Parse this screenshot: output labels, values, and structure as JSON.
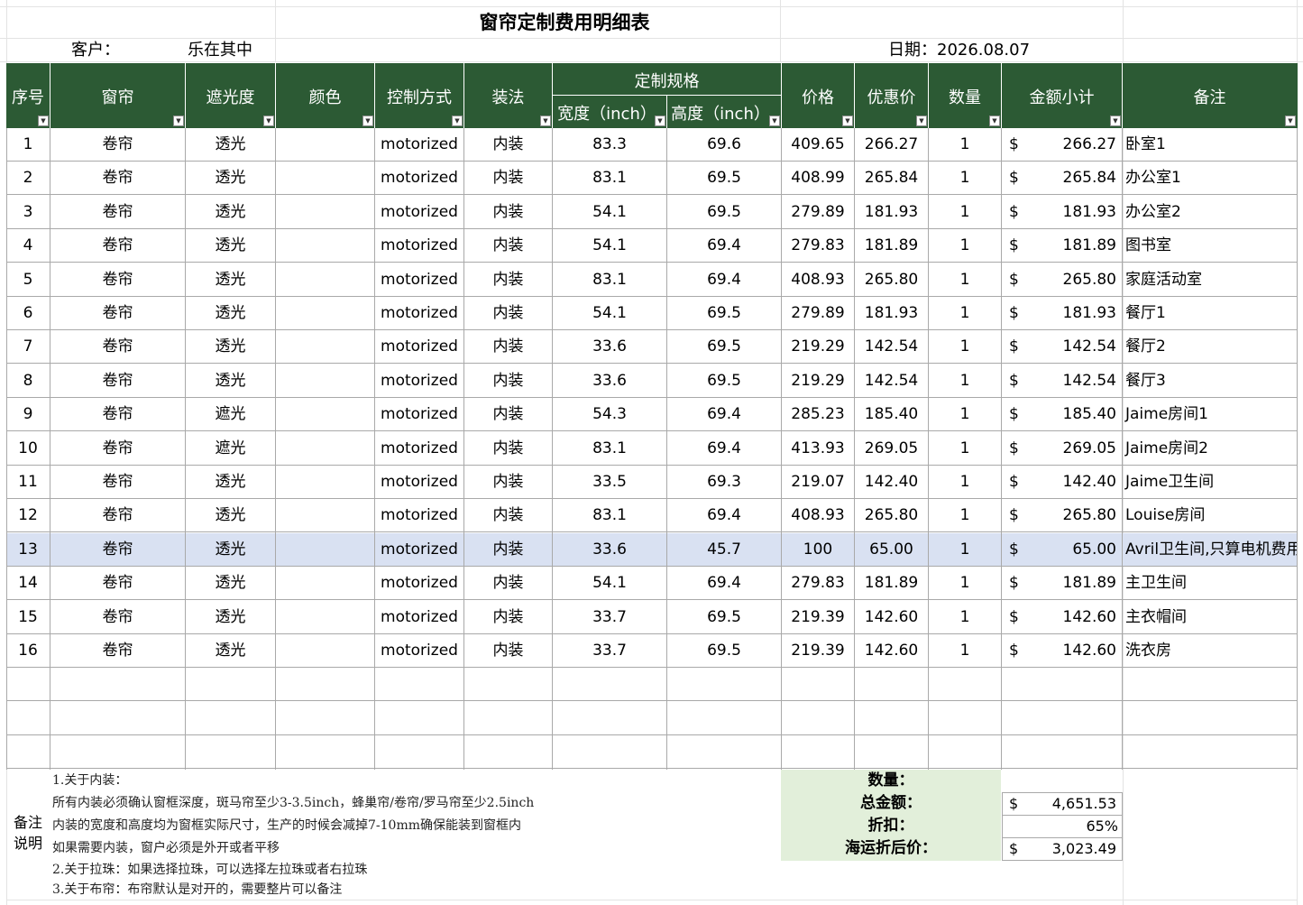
{
  "title": "窗帘定制费用明细表",
  "customer_label": "客户：",
  "customer_name": "乐在其中",
  "date_text": "日期：2026.08.07",
  "header": {
    "seq": "序号",
    "curtain": "窗帘",
    "shading": "遮光度",
    "color": "颜色",
    "control": "控制方式",
    "install": "装法",
    "spec": "定制规格",
    "width": "宽度（inch）",
    "height": "高度（inch）",
    "price": "价格",
    "discount_price": "优惠价",
    "qty": "数量",
    "subtotal": "金额小计",
    "note": "备注"
  },
  "rows": [
    {
      "seq": "1",
      "curtain": "卷帘",
      "shading": "透光",
      "color": "",
      "control": "motorized",
      "install": "内装",
      "width": "83.3",
      "height": "69.6",
      "price": "409.65",
      "dprice": "266.27",
      "qty": "1",
      "cur": "$",
      "subtotal": "266.27",
      "note": "卧室1"
    },
    {
      "seq": "2",
      "curtain": "卷帘",
      "shading": "透光",
      "color": "",
      "control": "motorized",
      "install": "内装",
      "width": "83.1",
      "height": "69.5",
      "price": "408.99",
      "dprice": "265.84",
      "qty": "1",
      "cur": "$",
      "subtotal": "265.84",
      "note": "办公室1"
    },
    {
      "seq": "3",
      "curtain": "卷帘",
      "shading": "透光",
      "color": "",
      "control": "motorized",
      "install": "内装",
      "width": "54.1",
      "height": "69.5",
      "price": "279.89",
      "dprice": "181.93",
      "qty": "1",
      "cur": "$",
      "subtotal": "181.93",
      "note": "办公室2"
    },
    {
      "seq": "4",
      "curtain": "卷帘",
      "shading": "透光",
      "color": "",
      "control": "motorized",
      "install": "内装",
      "width": "54.1",
      "height": "69.4",
      "price": "279.83",
      "dprice": "181.89",
      "qty": "1",
      "cur": "$",
      "subtotal": "181.89",
      "note": "图书室"
    },
    {
      "seq": "5",
      "curtain": "卷帘",
      "shading": "透光",
      "color": "",
      "control": "motorized",
      "install": "内装",
      "width": "83.1",
      "height": "69.4",
      "price": "408.93",
      "dprice": "265.80",
      "qty": "1",
      "cur": "$",
      "subtotal": "265.80",
      "note": "家庭活动室"
    },
    {
      "seq": "6",
      "curtain": "卷帘",
      "shading": "透光",
      "color": "",
      "control": "motorized",
      "install": "内装",
      "width": "54.1",
      "height": "69.5",
      "price": "279.89",
      "dprice": "181.93",
      "qty": "1",
      "cur": "$",
      "subtotal": "181.93",
      "note": "餐厅1"
    },
    {
      "seq": "7",
      "curtain": "卷帘",
      "shading": "透光",
      "color": "",
      "control": "motorized",
      "install": "内装",
      "width": "33.6",
      "height": "69.5",
      "price": "219.29",
      "dprice": "142.54",
      "qty": "1",
      "cur": "$",
      "subtotal": "142.54",
      "note": "餐厅2"
    },
    {
      "seq": "8",
      "curtain": "卷帘",
      "shading": "透光",
      "color": "",
      "control": "motorized",
      "install": "内装",
      "width": "33.6",
      "height": "69.5",
      "price": "219.29",
      "dprice": "142.54",
      "qty": "1",
      "cur": "$",
      "subtotal": "142.54",
      "note": "餐厅3"
    },
    {
      "seq": "9",
      "curtain": "卷帘",
      "shading": "遮光",
      "color": "",
      "control": "motorized",
      "install": "内装",
      "width": "54.3",
      "height": "69.4",
      "price": "285.23",
      "dprice": "185.40",
      "qty": "1",
      "cur": "$",
      "subtotal": "185.40",
      "note": "Jaime房间1"
    },
    {
      "seq": "10",
      "curtain": "卷帘",
      "shading": "遮光",
      "color": "",
      "control": "motorized",
      "install": "内装",
      "width": "83.1",
      "height": "69.4",
      "price": "413.93",
      "dprice": "269.05",
      "qty": "1",
      "cur": "$",
      "subtotal": "269.05",
      "note": "Jaime房间2"
    },
    {
      "seq": "11",
      "curtain": "卷帘",
      "shading": "透光",
      "color": "",
      "control": "motorized",
      "install": "内装",
      "width": "33.5",
      "height": "69.3",
      "price": "219.07",
      "dprice": "142.40",
      "qty": "1",
      "cur": "$",
      "subtotal": "142.40",
      "note": "Jaime卫生间"
    },
    {
      "seq": "12",
      "curtain": "卷帘",
      "shading": "透光",
      "color": "",
      "control": "motorized",
      "install": "内装",
      "width": "83.1",
      "height": "69.4",
      "price": "408.93",
      "dprice": "265.80",
      "qty": "1",
      "cur": "$",
      "subtotal": "265.80",
      "note": "Louise房间"
    },
    {
      "seq": "13",
      "curtain": "卷帘",
      "shading": "透光",
      "color": "",
      "control": "motorized",
      "install": "内装",
      "width": "33.6",
      "height": "45.7",
      "price": "100",
      "dprice": "65.00",
      "qty": "1",
      "cur": "$",
      "subtotal": "65.00",
      "note": "Avril卫生间,只算电机费用"
    },
    {
      "seq": "14",
      "curtain": "卷帘",
      "shading": "透光",
      "color": "",
      "control": "motorized",
      "install": "内装",
      "width": "54.1",
      "height": "69.4",
      "price": "279.83",
      "dprice": "181.89",
      "qty": "1",
      "cur": "$",
      "subtotal": "181.89",
      "note": "主卫生间"
    },
    {
      "seq": "15",
      "curtain": "卷帘",
      "shading": "透光",
      "color": "",
      "control": "motorized",
      "install": "内装",
      "width": "33.7",
      "height": "69.5",
      "price": "219.39",
      "dprice": "142.60",
      "qty": "1",
      "cur": "$",
      "subtotal": "142.60",
      "note": "主衣帽间"
    },
    {
      "seq": "16",
      "curtain": "卷帘",
      "shading": "透光",
      "color": "",
      "control": "motorized",
      "install": "内装",
      "width": "33.7",
      "height": "69.5",
      "price": "219.39",
      "dprice": "142.60",
      "qty": "1",
      "cur": "$",
      "subtotal": "142.60",
      "note": "洗衣房"
    }
  ],
  "highlighted_row": 13,
  "remarks": {
    "label_line1": "备注",
    "label_line2": "说明",
    "lines": [
      "1.关于内装：",
      "所有内装必须确认窗框深度，斑马帘至少3-3.5inch，蜂巢帘/卷帘/罗马帘至少2.5inch",
      "内装的宽度和高度均为窗框实际尺寸，生产的时候会减掉7-10mm确保能装到窗框内",
      "如果需要内装，窗户必须是外开或者平移",
      "2.关于拉珠：如果选择拉珠，可以选择左拉珠或者右拉珠",
      "3.关于布帘：布帘默认是对开的，需要整片可以备注"
    ]
  },
  "summary": {
    "qty_label": "数量：",
    "total_label": "总金额：",
    "total_cur": "$",
    "total_value": "4,651.53",
    "discount_label": "折扣：",
    "discount_value": "65%",
    "final_label": "海运折后价：",
    "final_cur": "$",
    "final_value": "3,023.49"
  },
  "colors": {
    "header_bg": "#2c5a34",
    "highlight_row": "#d9e1f2",
    "summary_bg": "#e2efda"
  }
}
